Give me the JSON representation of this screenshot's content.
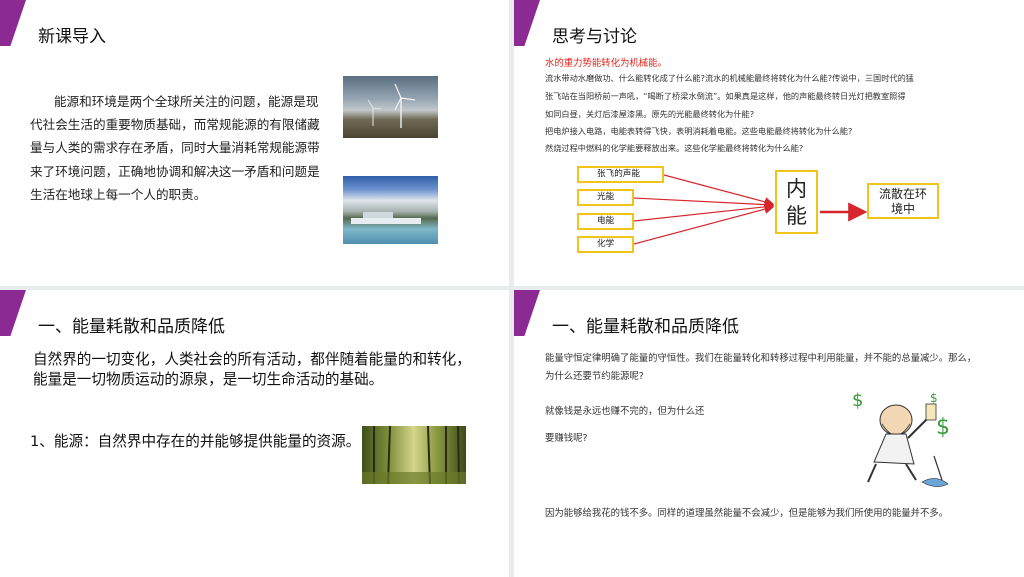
{
  "slide1": {
    "title": "新课导入",
    "paragraph": "能源和环境是两个全球所关注的问题，能源是现代社会生活的重要物质基础，而常规能源的有限储藏量与人类的需求存在矛盾，同时大量消耗常规能源带来了环境问题，正确地协调和解决这一矛盾和问题是生活在地球上每一个人的职责。",
    "images": [
      "wind-turbine-photo",
      "hydropower-dam-photo"
    ]
  },
  "slide2": {
    "title": "思考与讨论",
    "red_note": "水的重力势能转化为机械能。",
    "lines": [
      "流水带动水磨做功、什么能转化成了什么能?流水的机械能最终将转化为什么能?传说中，三国时代的猛",
      "张飞站在当阳桥前一声吼，“喝断了桥梁水倒流”。如果真是这样，他的声能最终转日光灯把教室照得",
      "如同白昼，关灯后漆屋漆黑。原先的光能最终转化为什能?",
      "把电炉接入电路，电能表转得飞快，表明消耗着电能。这些电能最终将转化为什么能?",
      "然烧过程中燃料的化学能要释放出来。这些化学能最终将转化为什么能?"
    ],
    "diagram": {
      "sources": [
        "张飞的声能",
        "光能",
        "电能",
        "化学"
      ],
      "center": [
        "内",
        "能"
      ],
      "target": [
        "流散在环",
        "境中"
      ],
      "arrow_color": "#d6262d",
      "box_color": "#f0c419"
    }
  },
  "slide3": {
    "title": "一、能量耗散和品质降低",
    "text": "自然界的一切变化，人类社会的所有活动，都伴随着能量的和转化，能量是一切物质运动的源泉，是一切生命活动的基础。",
    "definition": "1、能源：自然界中存在的并能够提供能量的资源。",
    "image": "forest-photo"
  },
  "slide4": {
    "title": "一、能量耗散和品质降低",
    "p1": "能量守恒定律明确了能量的守恒性。我们在能量转化和转移过程中利用能量，并不能的总量减少。那么，为什么还要节约能源呢?",
    "p2": "就像钱是永远也赚不完的，但为什么还",
    "p3": "要赚钱呢?",
    "p4": "因为能够给我花的钱不多。同样的道理虽然能量不会减少，但是能够为我们所使用的能量并不多。",
    "image": "money-cartoon"
  },
  "colors": {
    "accent": "#8b2a93",
    "note_red": "#e1251b"
  }
}
